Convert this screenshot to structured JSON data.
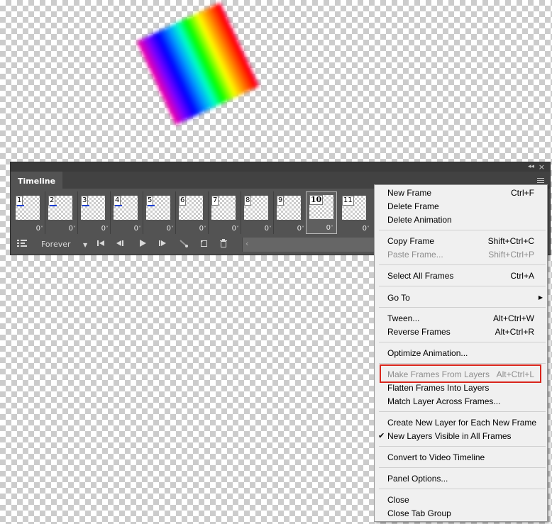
{
  "panel": {
    "title": "Timeline",
    "collapse_glyph": "◂◂",
    "close_glyph": "×",
    "frames": [
      {
        "num": "1",
        "delay": "0"
      },
      {
        "num": "2",
        "delay": "0"
      },
      {
        "num": "3",
        "delay": "0"
      },
      {
        "num": "4",
        "delay": "0"
      },
      {
        "num": "5",
        "delay": "0"
      },
      {
        "num": "6",
        "delay": "0"
      },
      {
        "num": "7",
        "delay": "0"
      },
      {
        "num": "8",
        "delay": "0"
      },
      {
        "num": "9",
        "delay": "0"
      },
      {
        "num": "10",
        "delay": "0",
        "selected": true
      },
      {
        "num": "11",
        "delay": "0"
      }
    ],
    "toolbar": {
      "loop_option": "Forever",
      "icons": [
        "convert-timeline-icon",
        "first-frame-icon",
        "previous-frame-icon",
        "play-icon",
        "next-frame-icon",
        "tween-icon",
        "duplicate-frame-icon",
        "delete-frame-icon"
      ]
    }
  },
  "menu": {
    "new_frame": {
      "label": "New Frame",
      "shortcut": "Ctrl+F"
    },
    "delete_frame": {
      "label": "Delete Frame"
    },
    "delete_animation": {
      "label": "Delete Animation"
    },
    "copy_frame": {
      "label": "Copy Frame",
      "shortcut": "Shift+Ctrl+C"
    },
    "paste_frame": {
      "label": "Paste Frame...",
      "shortcut": "Shift+Ctrl+P"
    },
    "select_all": {
      "label": "Select All Frames",
      "shortcut": "Ctrl+A"
    },
    "go_to": {
      "label": "Go To"
    },
    "tween": {
      "label": "Tween...",
      "shortcut": "Alt+Ctrl+W"
    },
    "reverse": {
      "label": "Reverse Frames",
      "shortcut": "Alt+Ctrl+R"
    },
    "optimize": {
      "label": "Optimize Animation..."
    },
    "make_frames": {
      "label": "Make Frames From Layers",
      "shortcut": "Alt+Ctrl+L"
    },
    "flatten": {
      "label": "Flatten Frames Into Layers"
    },
    "match_layer": {
      "label": "Match Layer Across Frames..."
    },
    "create_new_layer": {
      "label": "Create New Layer for Each New Frame"
    },
    "new_layers_visible": {
      "label": "New Layers Visible in All Frames",
      "checked": true
    },
    "convert_video": {
      "label": "Convert to Video Timeline"
    },
    "panel_options": {
      "label": "Panel Options..."
    },
    "close": {
      "label": "Close"
    },
    "close_tab_group": {
      "label": "Close Tab Group"
    }
  },
  "colors": {
    "highlight_box": "#d9261c",
    "panel_bg": "#535353",
    "menu_bg": "#f0f0f0"
  }
}
